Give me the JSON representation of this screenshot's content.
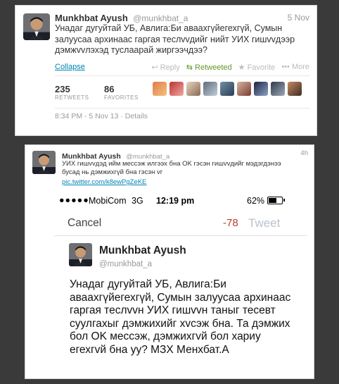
{
  "tweet_card": {
    "name": "Munkhbat Ayush",
    "handle": "@munkhbat_a",
    "date": "5 Nov",
    "text": "Унадаг дугуйтай УБ, Авлига:Би аваахгүйегехгүй, Сумын залуусаа архинаас гаргая теслvvдийг нийт УИХ гишvvдээр дэмжvvлэхэд туслаарай жиргээчдээ?",
    "collapse_label": "Collapse",
    "actions": {
      "reply": "Reply",
      "retweeted": "Retweeted",
      "favorite": "Favorite",
      "more": "More"
    },
    "retweets_count": "235",
    "retweets_label": "RETWEETS",
    "favorites_count": "86",
    "favorites_label": "FAVORITES",
    "meta": "8:34 PM - 5 Nov 13 · Details"
  },
  "reply_card": {
    "name": "Munkhbat Ayush",
    "handle": "@munkhbat_a",
    "time": "4h",
    "text": "УИХ гишvvдэд ийм мессэж илгээх бна OK гэсэн гишvvдийг мэдэгдэнээ бусад нь дэмжихгүй бна гэсэн vг",
    "link": "pic.twitter.com/k8ewPgZeKE"
  },
  "phone": {
    "status": {
      "signal": "●●●●●",
      "carrier": "MobiCom",
      "network": "3G",
      "time": "12:19 pm",
      "battery": "62%",
      "battery_level": 0.62
    },
    "cancel_label": "Cancel",
    "char_count": "-78",
    "tweet_label": "Tweet",
    "author_name": "Munkhbat Ayush",
    "author_handle": "@munkhbat_a",
    "draft_text": "Унадаг дугуйтай УБ, Авлига:Би аваахгүйегехгүй, Сумын залуусаа архинаас гаргая теслvvн УИХ гишvvн таныг тесевт суулгахыг дэмжихийг хvсэж бна. Та дэмжих бол OK мессэж, дэмжихгvй бол хариу егехгvй бна уу? МЗХ Менхбат.А"
  },
  "colors": {
    "link": "#0084b4",
    "retweeted": "#609928",
    "negative_count": "#c0392b",
    "disabled": "#b9c3ce"
  }
}
